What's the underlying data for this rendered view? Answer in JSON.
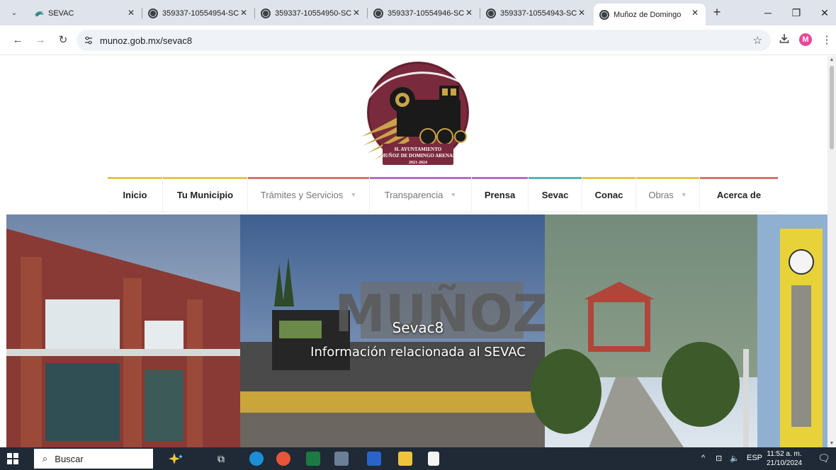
{
  "browser": {
    "tabs": [
      {
        "title": "SEVAC",
        "active": false
      },
      {
        "title": "359337-10554954-SC",
        "active": false
      },
      {
        "title": "359337-10554950-SC",
        "active": false
      },
      {
        "title": "359337-10554946-SC",
        "active": false
      },
      {
        "title": "359337-10554943-SC",
        "active": false
      },
      {
        "title": "Muñoz de Domingo",
        "active": true
      }
    ],
    "new_tab_symbol": "+",
    "url": "munoz.gob.mx/sevac8",
    "profile_initial": "M"
  },
  "site": {
    "logo": {
      "line1": "H. AYUNTAMIENTO",
      "line2": "MUÑOZ DE DOMINGO ARENAS",
      "line3": "2021-2024",
      "colors": {
        "circle": "#7a2a3d",
        "locomotive": "#1a1a1a",
        "rays": "#c9a448"
      }
    },
    "nav": [
      {
        "label": "Inicio",
        "bold": true,
        "dropdown": false,
        "accent": "#e7c54a"
      },
      {
        "label": "Tu Municipio",
        "bold": true,
        "dropdown": false,
        "accent": "#e7c54a"
      },
      {
        "label": "Trámites y Servicios",
        "bold": false,
        "dropdown": true,
        "accent": "#d9736b"
      },
      {
        "label": "Transparencia",
        "bold": false,
        "dropdown": true,
        "accent": "#b06fc8"
      },
      {
        "label": "Prensa",
        "bold": true,
        "dropdown": false,
        "accent": "#b06fc8"
      },
      {
        "label": "Sevac",
        "bold": true,
        "dropdown": false,
        "accent": "#4fb8b5"
      },
      {
        "label": "Conac",
        "bold": true,
        "dropdown": false,
        "accent": "#e7c54a"
      },
      {
        "label": "Obras",
        "bold": false,
        "dropdown": true,
        "accent": "#e7c54a"
      },
      {
        "label": "Acerca de",
        "bold": true,
        "dropdown": false,
        "accent": "#d9736b"
      }
    ],
    "hero": {
      "title": "Sevac8",
      "subtitle": "Información relacionada al SEVAC",
      "watermark": "MUÑOZ"
    }
  },
  "taskbar": {
    "search_placeholder": "Buscar",
    "language": "ESP",
    "time": "11:52 a. m.",
    "date": "21/10/2024"
  }
}
